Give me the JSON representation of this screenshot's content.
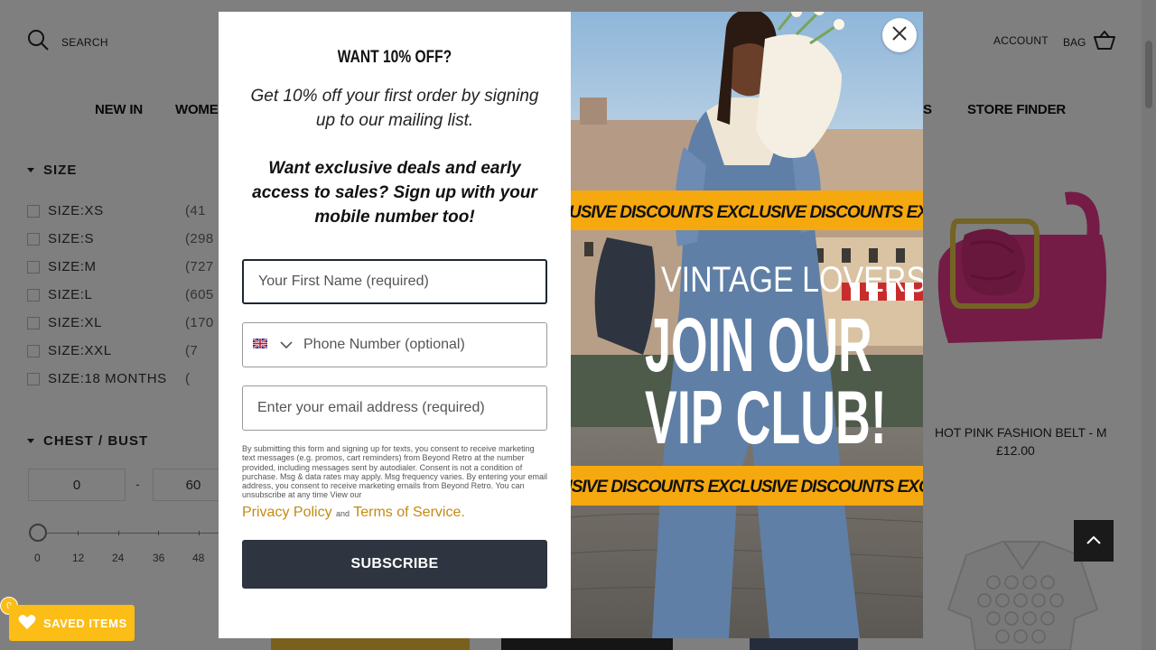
{
  "header": {
    "search_label": "SEARCH",
    "account_label": "ACCOUNT",
    "bag_label": "BAG"
  },
  "nav": {
    "new_in": "NEW IN",
    "women": "WOMEN",
    "partial_right": "LS",
    "store_finder": "STORE FINDER"
  },
  "filters": {
    "size_title": "SIZE",
    "sizes": [
      {
        "label": "SIZE:XS",
        "count": "(41"
      },
      {
        "label": "SIZE:S",
        "count": "(298"
      },
      {
        "label": "SIZE:M",
        "count": "(727"
      },
      {
        "label": "SIZE:L",
        "count": "(605"
      },
      {
        "label": "SIZE:XL",
        "count": "(170"
      },
      {
        "label": "SIZE:XXL",
        "count": "(7"
      },
      {
        "label": "SIZE:18 MONTHS",
        "count": "("
      }
    ],
    "chest_title": "CHEST / BUST",
    "range_min": "0",
    "range_dash": "-",
    "range_max": "60",
    "ticks": [
      "0",
      "12",
      "24",
      "36",
      "48"
    ]
  },
  "product": {
    "name": "HOT PINK FASHION BELT - M",
    "price": "£12.00"
  },
  "saved": {
    "label": "SAVED ITEMS",
    "count": "0"
  },
  "modal": {
    "title": "WANT 10% OFF?",
    "subtitle": "Get 10% off your first order by signing up to our mailing list.",
    "subtitle2": "Want exclusive deals and early access to sales? Sign up with your mobile number too!",
    "first_name_placeholder": "Your First Name (required)",
    "phone_placeholder": "Phone Number (optional)",
    "email_placeholder": "Enter your email address (required)",
    "legal": "By submitting this form and signing up for texts, you consent to receive marketing text messages (e.g. promos, cart reminders) from Beyond Retro at the number provided, including messages sent by autodialer. Consent is not a condition of purchase. Msg & data rates may apply. Msg frequency varies. By entering your email address, you consent to receive marketing emails from Beyond Retro. You can unsubscribe at any time  View our",
    "privacy_link": "Privacy Policy",
    "and": "and",
    "terms_link": "Terms of Service",
    "terms_period": ".",
    "subscribe_label": "SUBSCRIBE",
    "banner_top": "USIVE DISCOUNTS   EXCLUSIVE DISCOUNTS   EXC",
    "banner_bottom": "USIVE DISCOUNTS   EXCLUSIVE DISCOUNTS   EXCL",
    "promo_line1": "VINTAGE LOVERS",
    "promo_line2": "JOIN OUR",
    "promo_line3": "VIP CLUB!"
  },
  "colors": {
    "accent_yellow": "#fbbd16",
    "banner_yellow": "#f6a80f",
    "button_dark": "#2e3540",
    "link_gold": "#c58a12"
  }
}
